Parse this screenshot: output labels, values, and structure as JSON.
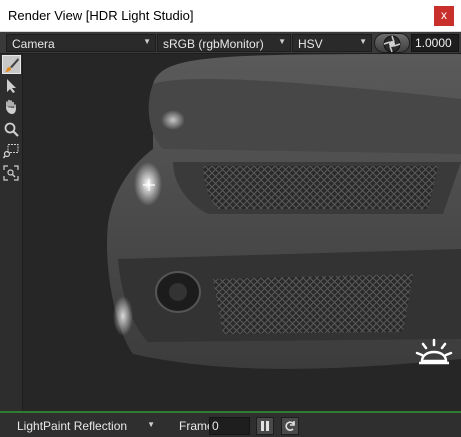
{
  "window": {
    "title": "Render View [HDR Light Studio]",
    "close_label": "x"
  },
  "toolbar": {
    "camera": {
      "selected": "Camera"
    },
    "color_space": {
      "selected": "sRGB (rgbMonitor)"
    },
    "color_model": {
      "selected": "HSV"
    },
    "exposure_icon": "aperture-icon",
    "exposure_value": "1.0000"
  },
  "sidebar": {
    "tools": [
      {
        "icon": "paint-brush-icon",
        "active": true
      },
      {
        "icon": "select-arrow-icon",
        "active": false
      },
      {
        "icon": "hand-icon",
        "active": false
      },
      {
        "icon": "zoom-icon",
        "active": false
      },
      {
        "icon": "zoom-region-icon",
        "active": false
      },
      {
        "icon": "zoom-fit-icon",
        "active": false
      }
    ]
  },
  "viewport": {
    "overlay_icon": "light-bulb-icon"
  },
  "bottombar": {
    "mode": {
      "selected": "LightPaint Reflection"
    },
    "frame_label": "Frame",
    "frame_value": "0",
    "pause_icon": "pause-icon",
    "refresh_icon": "refresh-icon"
  },
  "colors": {
    "accent_green": "#2e7d32",
    "close_red": "#c9302c"
  }
}
